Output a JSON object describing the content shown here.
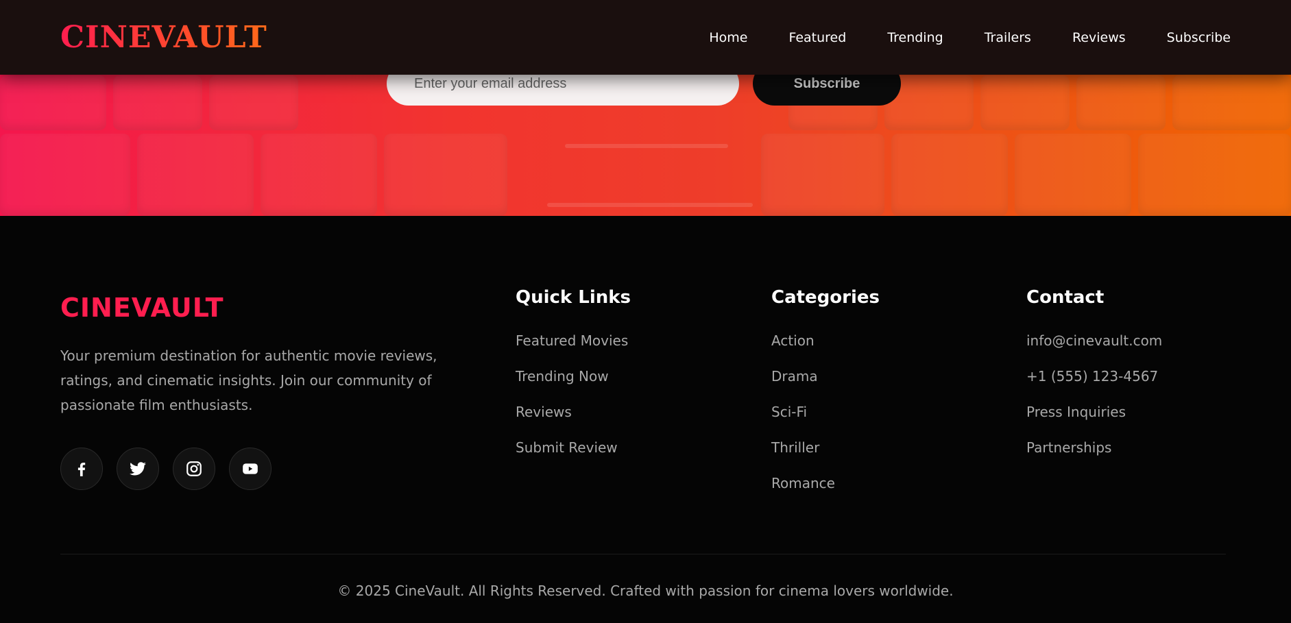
{
  "header": {
    "logo": "CINEVAULT",
    "nav": [
      "Home",
      "Featured",
      "Trending",
      "Trailers",
      "Reviews",
      "Subscribe"
    ]
  },
  "subscribe": {
    "placeholder": "Enter your email address",
    "button_label": "Subscribe"
  },
  "footer": {
    "brand": {
      "logo": "CINEVAULT",
      "description": "Your premium destination for authentic movie reviews, ratings, and cinematic insights. Join our community of passionate film enthusiasts.",
      "socials": [
        "facebook-icon",
        "twitter-icon",
        "instagram-icon",
        "youtube-icon"
      ]
    },
    "quick_links": {
      "title": "Quick Links",
      "items": [
        "Featured Movies",
        "Trending Now",
        "Reviews",
        "Submit Review"
      ]
    },
    "categories": {
      "title": "Categories",
      "items": [
        "Action",
        "Drama",
        "Sci-Fi",
        "Thriller",
        "Romance"
      ]
    },
    "contact": {
      "title": "Contact",
      "items": [
        "info@cinevault.com",
        "+1 (555) 123-4567",
        "Press Inquiries",
        "Partnerships"
      ]
    },
    "copyright": "© 2025 CineVault. All Rights Reserved. Crafted with passion for cinema lovers worldwide."
  },
  "colors": {
    "accent": "#ff1e4f",
    "gradient_start": "#f4164d",
    "gradient_end": "#f06500",
    "background": "#050505"
  }
}
